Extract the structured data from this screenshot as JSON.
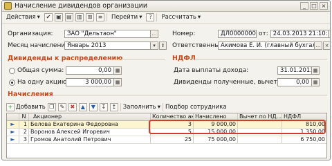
{
  "window": {
    "title": "Начисление дивидендов организации"
  },
  "toolbar": {
    "actions_label": "Действия",
    "goto_label": "Перейти",
    "help_label": "?",
    "calculate_label": "Рассчитать"
  },
  "header": {
    "org_label": "Организация:",
    "org_value": "ЗАО \"Дельтаон\"",
    "month_label": "Месяц начисления:",
    "month_value": "Январь 2013",
    "number_label": "Номер:",
    "number_value": "ДЛ000000001",
    "from_label": "от:",
    "date_value": "24.03.2013 21:10:02",
    "responsible_label": "Ответственный:",
    "responsible_value": "Акимова Е. И. (главный бухгалте"
  },
  "dividends": {
    "section_title": "Дивиденды к распределению",
    "total_label": "Общая сумма:",
    "total_value": "0,00",
    "per_share_label": "На одну акцию:",
    "per_share_value": "3 000,00"
  },
  "ndfl": {
    "section_title": "НДФЛ",
    "pay_date_label": "Дата выплаты дохода:",
    "pay_date_value": "31.01.2013",
    "received_label": "Дивиденды полученные, вычет по налогу:",
    "received_value": "0,00"
  },
  "accruals": {
    "section_title": "Начисления",
    "add_label": "Добавить",
    "fill_label": "Заполнить",
    "select_label": "Подбор сотрудника",
    "columns": [
      "N",
      "Акционер",
      "Количество акц...",
      "Начислено",
      "Вычет по НД...",
      "НДФЛ"
    ],
    "rows": [
      {
        "n": "1",
        "name": "Белова Екатерина Федоровна",
        "qty": "3",
        "accrued": "9 000,00",
        "deduction": "",
        "ndfl": "810,00"
      },
      {
        "n": "2",
        "name": "Воронов Алексей Игоревич",
        "qty": "5",
        "accrued": "15 000,00",
        "deduction": "",
        "ndfl": "1 350,00"
      },
      {
        "n": "3",
        "name": "Громов Анатолий Петрович",
        "qty": "25",
        "accrued": "75 000,00",
        "deduction": "",
        "ndfl": "6 750,00"
      }
    ]
  },
  "colors": {
    "section_title": "#c04a1a",
    "highlight": "#d23a2a",
    "window_bg": "#f4f2ed"
  }
}
